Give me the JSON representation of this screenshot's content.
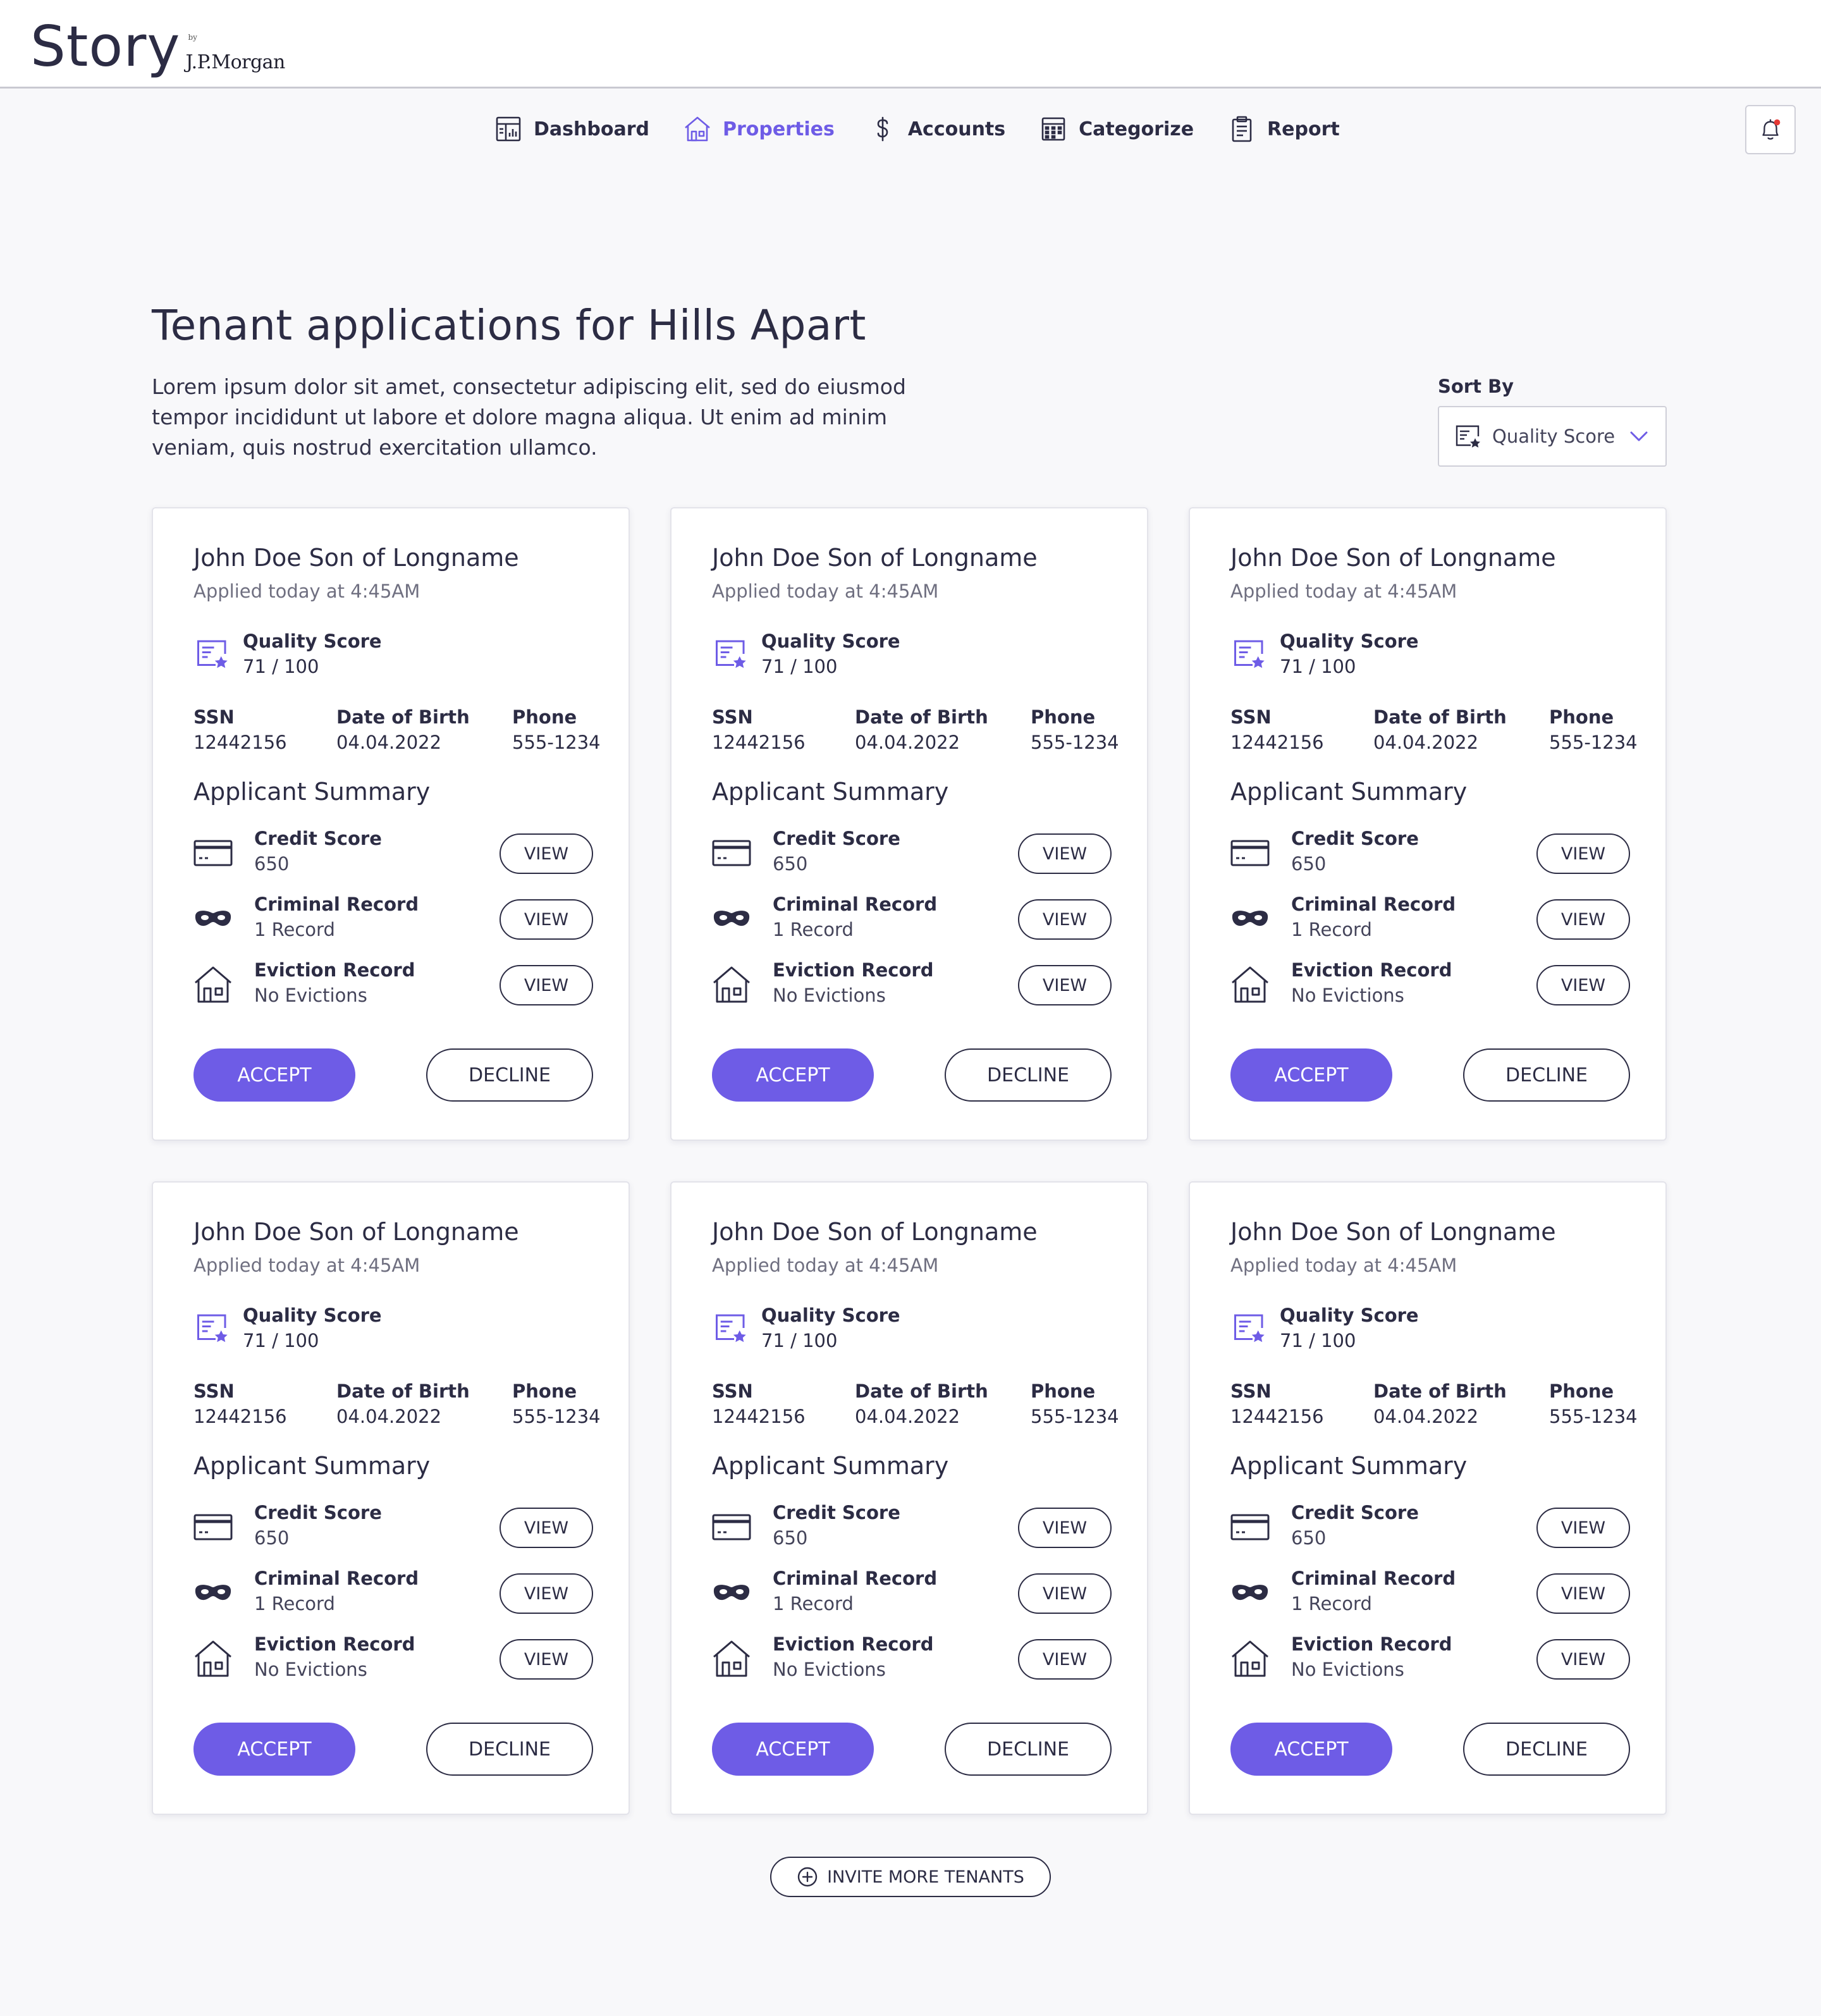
{
  "brand": {
    "name": "Story",
    "by": "by",
    "company": "J.P.Morgan"
  },
  "nav": {
    "items": [
      {
        "label": "Dashboard",
        "icon": "dashboard-icon",
        "active": false
      },
      {
        "label": "Properties",
        "icon": "home-icon",
        "active": true
      },
      {
        "label": "Accounts",
        "icon": "dollar-icon",
        "active": false
      },
      {
        "label": "Categorize",
        "icon": "calculator-icon",
        "active": false
      },
      {
        "label": "Report",
        "icon": "clipboard-icon",
        "active": false
      }
    ],
    "notifications_icon": "bell-icon"
  },
  "page": {
    "title": "Tenant applications for Hills Apart",
    "description": "Lorem ipsum dolor sit amet, consectetur adipiscing elit, sed do eiusmod tempor incididunt ut labore et dolore magna aliqua. Ut enim ad minim veniam, quis nostrud exercitation ullamco."
  },
  "sort": {
    "label": "Sort By",
    "value": "Quality Score",
    "icon": "quality-score-icon"
  },
  "labels": {
    "quality_score": "Quality Score",
    "ssn": "SSN",
    "dob": "Date of Birth",
    "phone": "Phone",
    "applicant_summary": "Applicant Summary",
    "credit_score": "Credit Score",
    "criminal_record": "Criminal Record",
    "eviction_record": "Eviction Record",
    "view": "VIEW",
    "accept": "ACCEPT",
    "decline": "DECLINE"
  },
  "applications": [
    {
      "name": "John Doe Son of Longname",
      "applied": "Applied today at 4:45AM",
      "quality_score": "71 / 100",
      "ssn": "12442156",
      "dob": "04.04.2022",
      "phone": "555-1234",
      "credit_score": "650",
      "criminal_record": "1 Record",
      "eviction_record": "No Evictions"
    },
    {
      "name": "John Doe Son of Longname",
      "applied": "Applied today at 4:45AM",
      "quality_score": "71 / 100",
      "ssn": "12442156",
      "dob": "04.04.2022",
      "phone": "555-1234",
      "credit_score": "650",
      "criminal_record": "1 Record",
      "eviction_record": "No Evictions"
    },
    {
      "name": "John Doe Son of Longname",
      "applied": "Applied today at 4:45AM",
      "quality_score": "71 / 100",
      "ssn": "12442156",
      "dob": "04.04.2022",
      "phone": "555-1234",
      "credit_score": "650",
      "criminal_record": "1 Record",
      "eviction_record": "No Evictions"
    },
    {
      "name": "John Doe Son of Longname",
      "applied": "Applied today at 4:45AM",
      "quality_score": "71 / 100",
      "ssn": "12442156",
      "dob": "04.04.2022",
      "phone": "555-1234",
      "credit_score": "650",
      "criminal_record": "1 Record",
      "eviction_record": "No Evictions"
    },
    {
      "name": "John Doe Son of Longname",
      "applied": "Applied today at 4:45AM",
      "quality_score": "71 / 100",
      "ssn": "12442156",
      "dob": "04.04.2022",
      "phone": "555-1234",
      "credit_score": "650",
      "criminal_record": "1 Record",
      "eviction_record": "No Evictions"
    },
    {
      "name": "John Doe Son of Longname",
      "applied": "Applied today at 4:45AM",
      "quality_score": "71 / 100",
      "ssn": "12442156",
      "dob": "04.04.2022",
      "phone": "555-1234",
      "credit_score": "650",
      "criminal_record": "1 Record",
      "eviction_record": "No Evictions"
    }
  ],
  "invite_button": {
    "label": "INVITE MORE TENANTS",
    "icon": "plus-circle-icon"
  },
  "colors": {
    "accent": "#6e5ce6",
    "text": "#2c2c44",
    "background": "#f8f8fa",
    "notification_dot": "#e53935"
  }
}
